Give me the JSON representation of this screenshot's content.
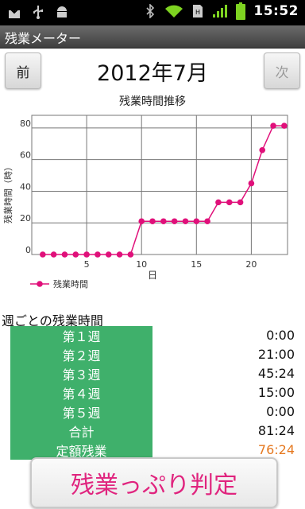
{
  "status_bar": {
    "time": "15:52",
    "icons": [
      "download-icon",
      "usb-icon",
      "android-debug-icon",
      "bluetooth-icon",
      "wifi-icon",
      "sim-icon",
      "signal-icon",
      "battery-icon"
    ]
  },
  "app": {
    "title": "残業メーター"
  },
  "nav": {
    "prev_label": "前",
    "next_label": "次",
    "month": "2012年7月"
  },
  "chart_data": {
    "type": "line",
    "title": "残業時間推移",
    "xlabel": "日",
    "ylabel": "残業時間（時）",
    "x": [
      1,
      2,
      3,
      4,
      5,
      6,
      7,
      8,
      9,
      10,
      11,
      12,
      13,
      14,
      15,
      16,
      17,
      18,
      19,
      20,
      21,
      22,
      23
    ],
    "series": [
      {
        "name": "残業時間",
        "values": [
          0,
          0,
          0,
          0,
          0,
          0,
          0,
          0,
          0,
          21,
          21,
          21,
          21,
          21,
          21,
          21,
          33,
          33,
          33,
          45,
          66,
          81.4,
          81.4
        ]
      }
    ],
    "xticks": [
      5,
      10,
      15,
      20
    ],
    "yticks": [
      0,
      20,
      40,
      60,
      80
    ],
    "xlim": [
      0,
      23.3
    ],
    "ylim": [
      0,
      88
    ],
    "grid": true,
    "legend": "bottom-left",
    "color": "#e0107a"
  },
  "weekly": {
    "title": "週ごとの残業時間",
    "rows": [
      {
        "label": "第１週",
        "value": "0:00"
      },
      {
        "label": "第２週",
        "value": "21:00"
      },
      {
        "label": "第３週",
        "value": "45:24"
      },
      {
        "label": "第４週",
        "value": "15:00"
      },
      {
        "label": "第５週",
        "value": "0:00"
      },
      {
        "label": "合計",
        "value": "81:24"
      },
      {
        "label": "定額残業",
        "value": "76:24",
        "color": "#e5781f"
      }
    ]
  },
  "judge_button": {
    "label": "残業っぷり判定"
  }
}
